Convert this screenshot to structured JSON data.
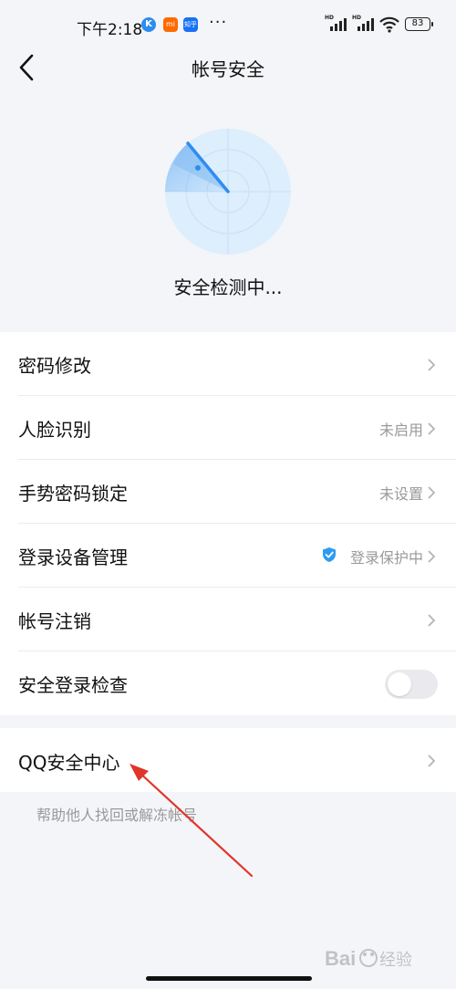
{
  "status_bar": {
    "time": "下午2:18",
    "badges": [
      "K",
      "mi",
      "知乎"
    ],
    "more": "···",
    "network_labels": [
      "HD",
      "HD"
    ],
    "battery": "83"
  },
  "header": {
    "title": "帐号安全",
    "back_icon": "chevron-left-icon"
  },
  "scan": {
    "status": "安全检测中...",
    "accent": "#2e8cf0",
    "radar_fill": "#d6e9fb"
  },
  "settings": {
    "items": [
      {
        "label": "密码修改",
        "value": ""
      },
      {
        "label": "人脸识别",
        "value": "未启用"
      },
      {
        "label": "手势密码锁定",
        "value": "未设置"
      },
      {
        "label": "登录设备管理",
        "value": "登录保护中",
        "icon": "shield-check-icon"
      },
      {
        "label": "帐号注销",
        "value": ""
      },
      {
        "label": "安全登录检查",
        "toggle": false
      }
    ]
  },
  "qq_center": {
    "label": "QQ安全中心",
    "helper": "帮助他人找回或解冻帐号"
  },
  "annotation": {
    "arrow_color": "#e0352b"
  },
  "watermark": {
    "text": "Baidu经验"
  }
}
